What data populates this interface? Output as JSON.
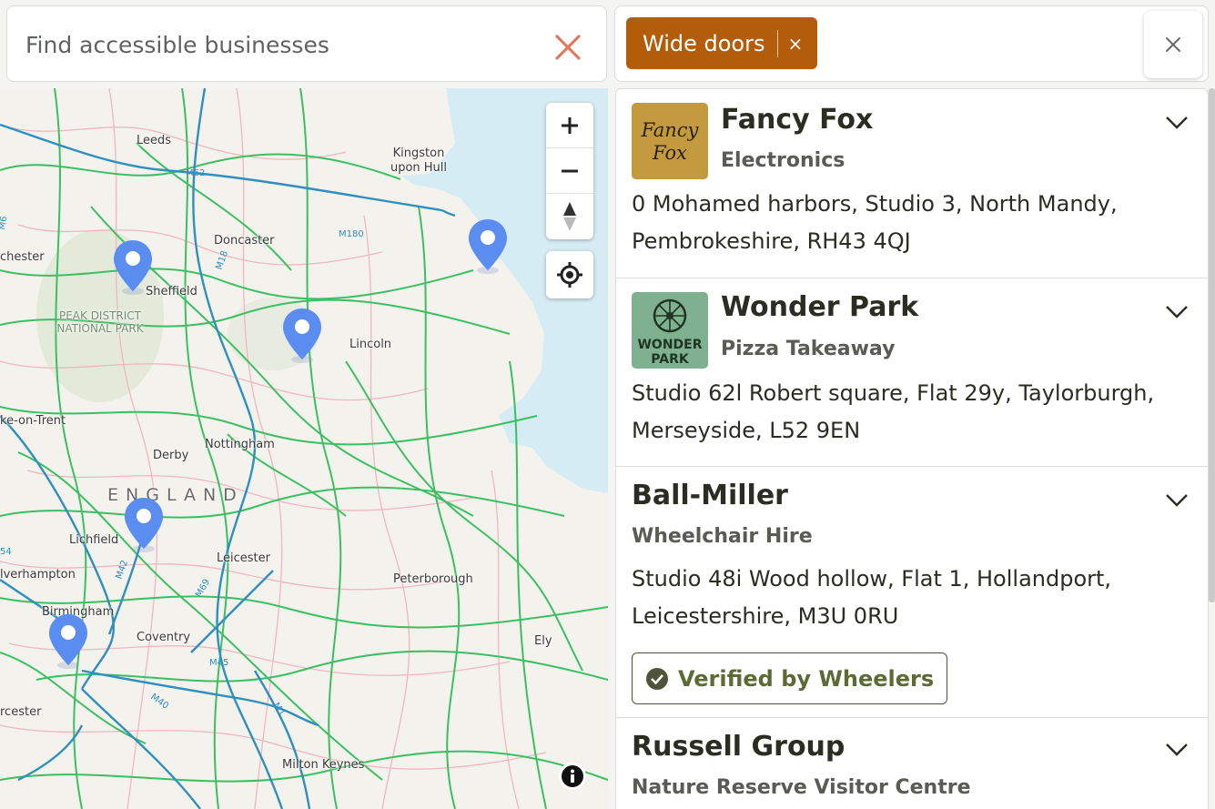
{
  "search": {
    "placeholder": "Find accessible businesses"
  },
  "filters": {
    "active": [
      {
        "label": "Wide doors",
        "remove_symbol": "×"
      }
    ],
    "close_icon": "close-icon"
  },
  "map": {
    "labels": {
      "leeds": "Leeds",
      "kingston": "Kingston upon Hull",
      "doncaster": "Doncaster",
      "chester": "chester",
      "sheffield": "Sheffield",
      "peak": "PEAK DISTRICT NATIONAL PARK",
      "lincoln": "Lincoln",
      "stoke": "ke-on-Trent",
      "derby": "Derby",
      "nottingham": "Nottingham",
      "england": "ENGLAND",
      "lichfield": "Lichfield",
      "leicester": "Leicester",
      "wolverhampton": "lverhampton",
      "peterborough": "Peterborough",
      "birmingham": "Birmingham",
      "coventry": "Coventry",
      "ely": "Ely",
      "worcester": "rcester",
      "milton_keynes": "Milton Keynes"
    },
    "road_labels": {
      "m62": "M62",
      "m180": "M180",
      "m18": "M18",
      "m1_north": "M1",
      "m42": "M42",
      "m69": "M69",
      "m45": "M45",
      "m40": "M40",
      "m1_south": "M1",
      "m6": "M6",
      "a54": "54"
    },
    "controls": {
      "zoom_in": "+",
      "zoom_out": "−"
    },
    "colors": {
      "water": "#d6ecf4",
      "land": "#f3f2ec",
      "motorway": "#2f8fbf",
      "road_green": "#3cbf63",
      "road_pink": "#f1b6bf",
      "pin": "#5b8cf0"
    },
    "pin_icon": "map-pin-icon"
  },
  "results": [
    {
      "name": "Fancy Fox",
      "category": "Electronics",
      "address": "0 Mohamed harbors, Studio 3, North Mandy, Pembrokeshire, RH43 4QJ",
      "logo_text_1": "Fancy",
      "logo_text_2": "Fox",
      "logo_color": "#c49a3f"
    },
    {
      "name": "Wonder Park",
      "category": "Pizza Takeaway",
      "address": "Studio 62l Robert square, Flat 29y, Taylorburgh, Merseyside, L52 9EN",
      "logo_text_1": "WONDER",
      "logo_text_2": "PARK",
      "logo_color": "#7fb08f"
    },
    {
      "name": "Ball-Miller",
      "category": "Wheelchair Hire",
      "address": "Studio 48i Wood hollow, Flat 1, Hollandport, Leicestershire, M3U 0RU",
      "badge": "Verified by Wheelers"
    },
    {
      "name": "Russell Group",
      "category": "Nature Reserve Visitor Centre"
    }
  ]
}
